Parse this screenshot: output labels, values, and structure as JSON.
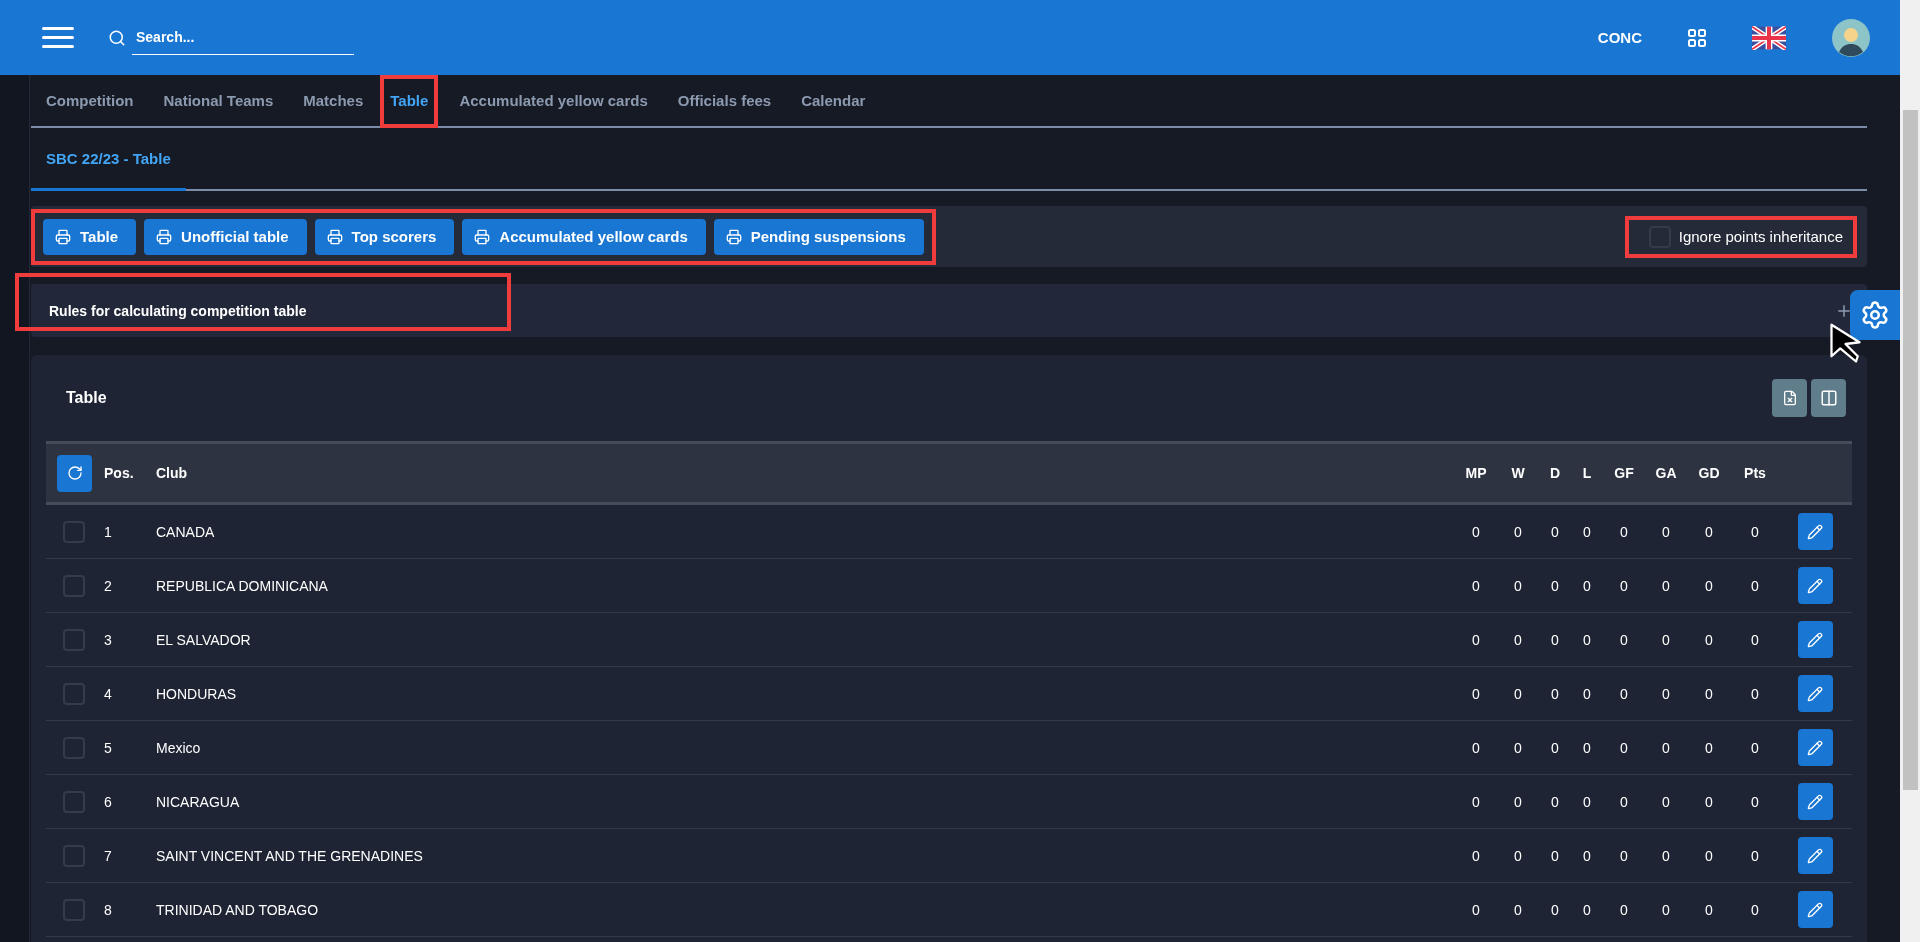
{
  "header": {
    "search_placeholder": "Search...",
    "organization": "CONC"
  },
  "tabs": [
    {
      "label": "Competition",
      "selected": false
    },
    {
      "label": "National Teams",
      "selected": false
    },
    {
      "label": "Matches",
      "selected": false
    },
    {
      "label": "Table",
      "selected": true
    },
    {
      "label": "Accumulated yellow cards",
      "selected": false
    },
    {
      "label": "Officials fees",
      "selected": false
    },
    {
      "label": "Calendar",
      "selected": false
    }
  ],
  "subtabs": [
    {
      "label": "SBC 22/23 - Table",
      "selected": true
    }
  ],
  "print_buttons": [
    "Table",
    "Unofficial table",
    "Top scorers",
    "Accumulated yellow cards",
    "Pending suspensions"
  ],
  "ignore_inheritance": {
    "label": "Ignore points inheritance",
    "checked": false
  },
  "rules": {
    "title": "Rules for calculating competition table",
    "expanded": false
  },
  "table": {
    "title": "Table",
    "columns": [
      "Pos.",
      "Club",
      "MP",
      "W",
      "D",
      "L",
      "GF",
      "GA",
      "GD",
      "Pts"
    ],
    "rows": [
      {
        "checked": false,
        "cells": [
          "1",
          "CANADA",
          "0",
          "0",
          "0",
          "0",
          "0",
          "0",
          "0",
          "0"
        ]
      },
      {
        "checked": false,
        "cells": [
          "2",
          "REPUBLICA DOMINICANA",
          "0",
          "0",
          "0",
          "0",
          "0",
          "0",
          "0",
          "0"
        ]
      },
      {
        "checked": false,
        "cells": [
          "3",
          "EL SALVADOR",
          "0",
          "0",
          "0",
          "0",
          "0",
          "0",
          "0",
          "0"
        ]
      },
      {
        "checked": false,
        "cells": [
          "4",
          "HONDURAS",
          "0",
          "0",
          "0",
          "0",
          "0",
          "0",
          "0",
          "0"
        ]
      },
      {
        "checked": false,
        "cells": [
          "5",
          "Mexico",
          "0",
          "0",
          "0",
          "0",
          "0",
          "0",
          "0",
          "0"
        ]
      },
      {
        "checked": false,
        "cells": [
          "6",
          "NICARAGUA",
          "0",
          "0",
          "0",
          "0",
          "0",
          "0",
          "0",
          "0"
        ]
      },
      {
        "checked": false,
        "cells": [
          "7",
          "SAINT VINCENT AND THE GRENADINES",
          "0",
          "0",
          "0",
          "0",
          "0",
          "0",
          "0",
          "0"
        ]
      },
      {
        "checked": false,
        "cells": [
          "8",
          "TRINIDAD AND TOBAGO",
          "0",
          "0",
          "0",
          "0",
          "0",
          "0",
          "0",
          "0"
        ]
      }
    ]
  }
}
